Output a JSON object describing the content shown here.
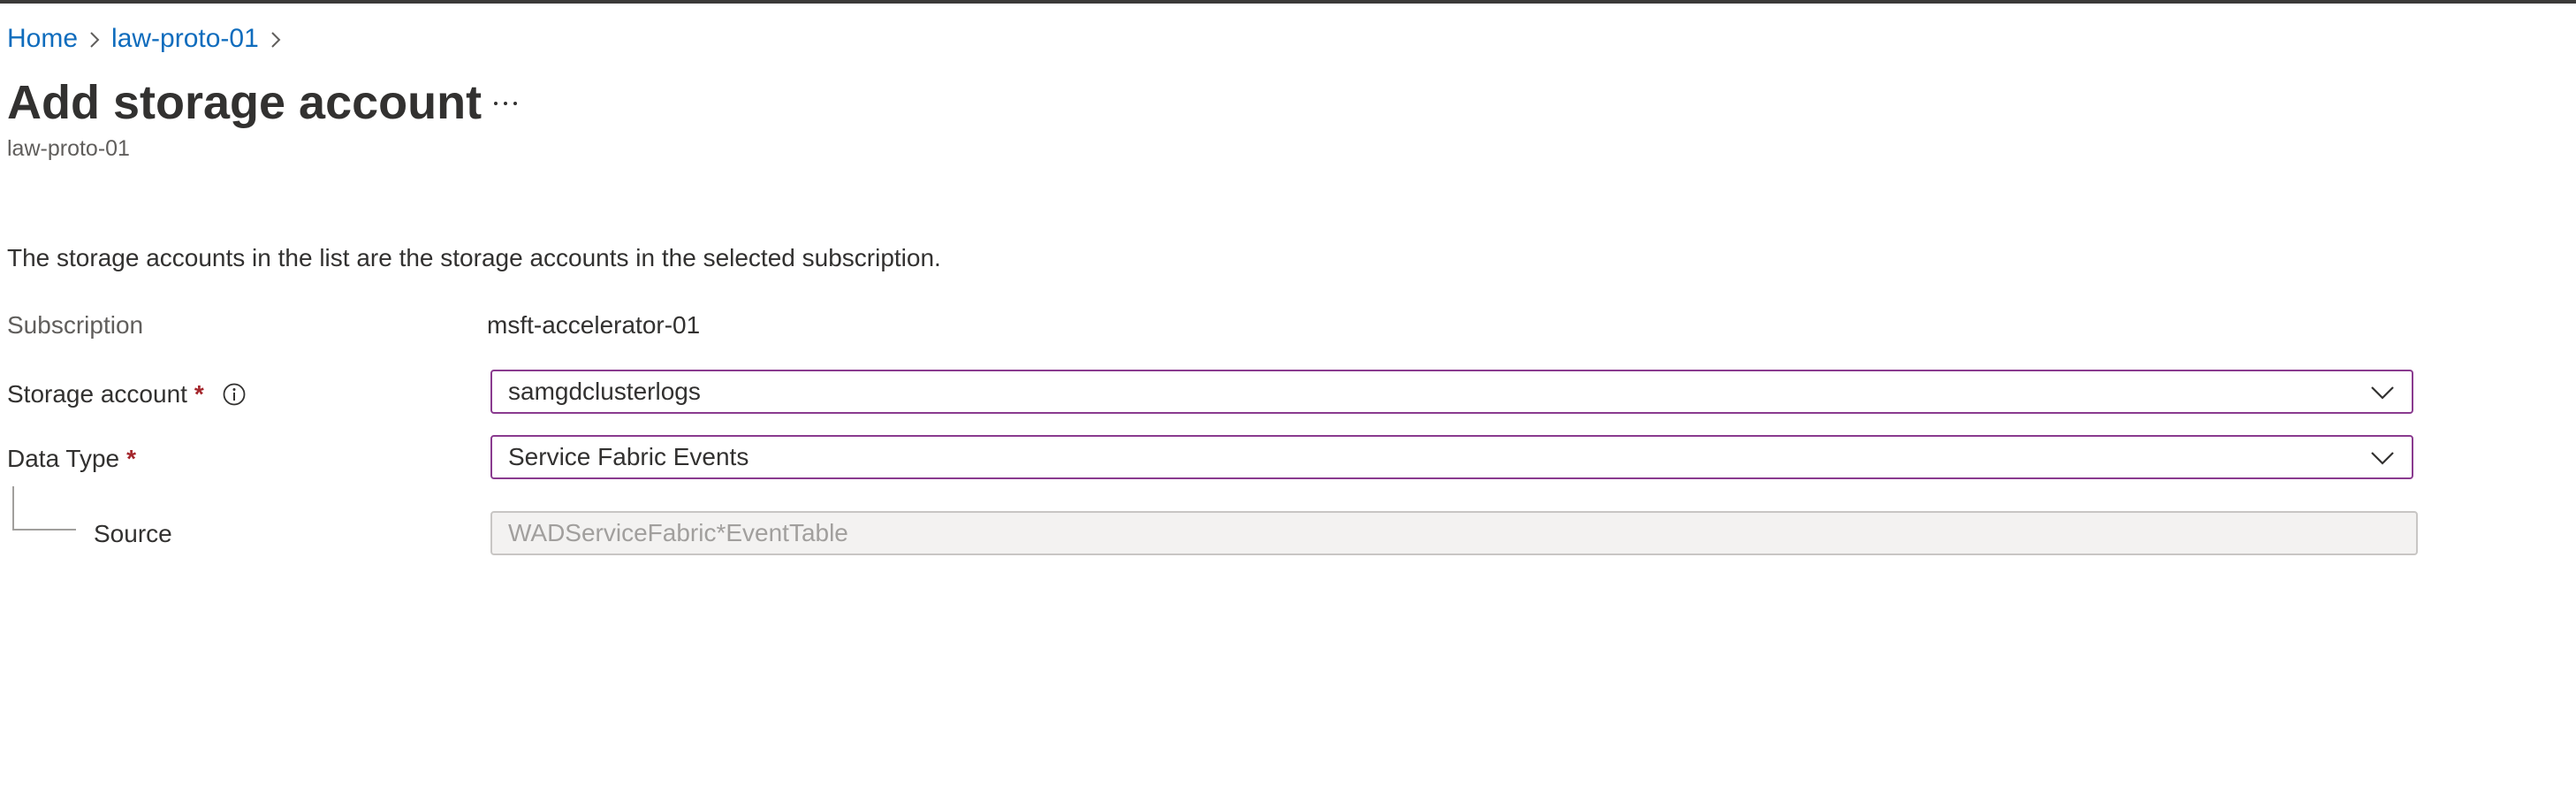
{
  "breadcrumb": {
    "items": [
      "Home",
      "law-proto-01"
    ]
  },
  "header": {
    "title": "Add storage account",
    "more_label": "···",
    "subtitle": "law-proto-01"
  },
  "main": {
    "description": "The storage accounts in the list are the storage accounts in the selected subscription.",
    "subscription": {
      "label": "Subscription",
      "value": "msft-accelerator-01"
    },
    "storage_account": {
      "label": "Storage account",
      "required": "*",
      "selected": "samgdclusterlogs"
    },
    "data_type": {
      "label": "Data Type",
      "required": "*",
      "selected": "Service Fabric Events"
    },
    "source": {
      "label": "Source",
      "value": "WADServiceFabric*EventTable"
    }
  },
  "colors": {
    "link": "#0f6cbd",
    "required": "#a4262c",
    "dropdown_border": "#8a3b8f",
    "disabled_bg": "#f3f2f1"
  },
  "icons": [
    "chevron-right-icon",
    "more-icon",
    "info-icon",
    "chevron-down-icon"
  ]
}
